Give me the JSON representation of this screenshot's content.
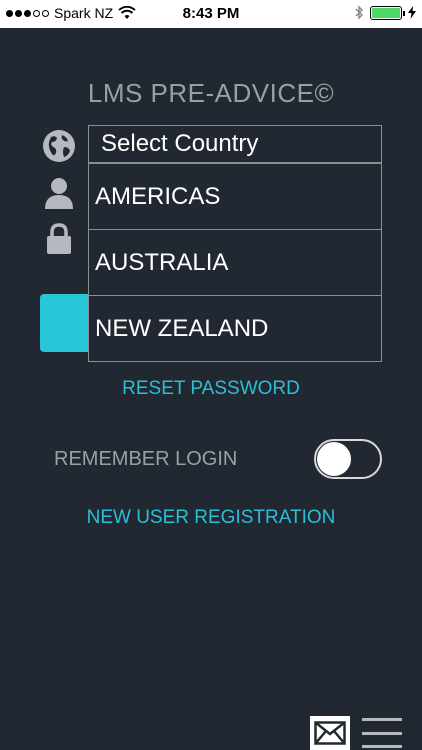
{
  "status_bar": {
    "carrier": "Spark NZ",
    "time": "8:43 PM",
    "signal_bars_filled": 3,
    "signal_bars_total": 5
  },
  "app": {
    "title": "LMS PRE-ADVICE©"
  },
  "country_select": {
    "header": "Select Country",
    "options": [
      "AMERICAS",
      "AUSTRALIA",
      "NEW ZEALAND"
    ]
  },
  "links": {
    "reset_password": "RESET PASSWORD",
    "new_user_registration": "NEW USER REGISTRATION"
  },
  "remember": {
    "label": "REMEMBER LOGIN",
    "enabled": false
  },
  "colors": {
    "background": "#222831",
    "accent": "#29c5d9",
    "muted_text": "#9a9ea6",
    "battery": "#4cd964"
  },
  "icons": [
    "globe-icon",
    "user-icon",
    "lock-icon",
    "mail-icon",
    "menu-icon",
    "wifi-icon",
    "bluetooth-icon",
    "battery-icon",
    "charging-icon"
  ]
}
